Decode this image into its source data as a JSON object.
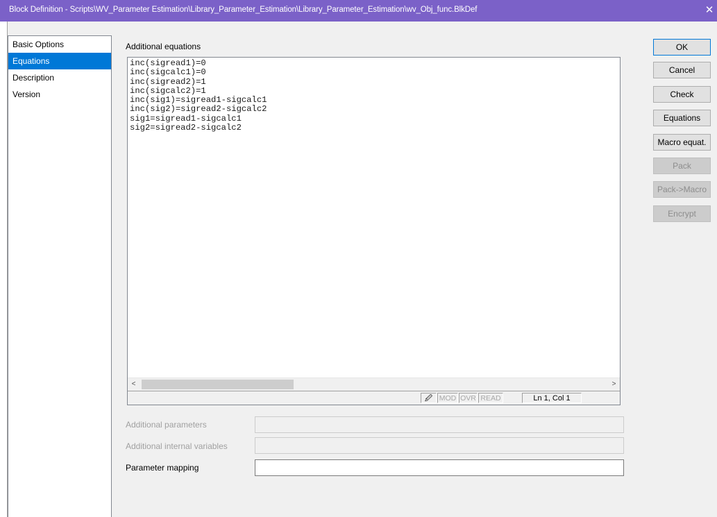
{
  "window": {
    "title": "Block Definition - Scripts\\WV_Parameter Estimation\\Library_Parameter_Estimation\\Library_Parameter_Estimation\\wv_Obj_func.BlkDef",
    "close_glyph": "✕"
  },
  "nav": {
    "items": [
      {
        "label": "Basic Options"
      },
      {
        "label": "Equations"
      },
      {
        "label": "Description"
      },
      {
        "label": "Version"
      }
    ]
  },
  "equations": {
    "section_label": "Additional equations",
    "code": "inc(sigread1)=0\ninc(sigcalc1)=0\ninc(sigread2)=1\ninc(sigcalc2)=1\ninc(sig1)=sigread1-sigcalc1\ninc(sig2)=sigread2-sigcalc2\nsig1=sigread1-sigcalc1\nsig2=sigread2-sigcalc2",
    "scroll_left": "<",
    "scroll_right": ">",
    "status": {
      "pen": "🖉",
      "mod": "MOD",
      "ovr": "OVR",
      "read": "READ",
      "position": "Ln 1, Col 1"
    }
  },
  "fields": {
    "additional_parameters": {
      "label": "Additional parameters",
      "value": ""
    },
    "additional_internal_variables": {
      "label": "Additional internal variables",
      "value": ""
    },
    "parameter_mapping": {
      "label": "Parameter mapping",
      "value": ""
    }
  },
  "buttons": {
    "ok": "OK",
    "cancel": "Cancel",
    "check": "Check",
    "equations": "Equations",
    "macro_equat": "Macro equat.",
    "pack": "Pack",
    "pack_macro": "Pack->Macro",
    "encrypt": "Encrypt"
  },
  "colors": {
    "titlebar": "#7b61c8",
    "selection": "#0078d7",
    "disabled_text": "#a0a0a0"
  }
}
